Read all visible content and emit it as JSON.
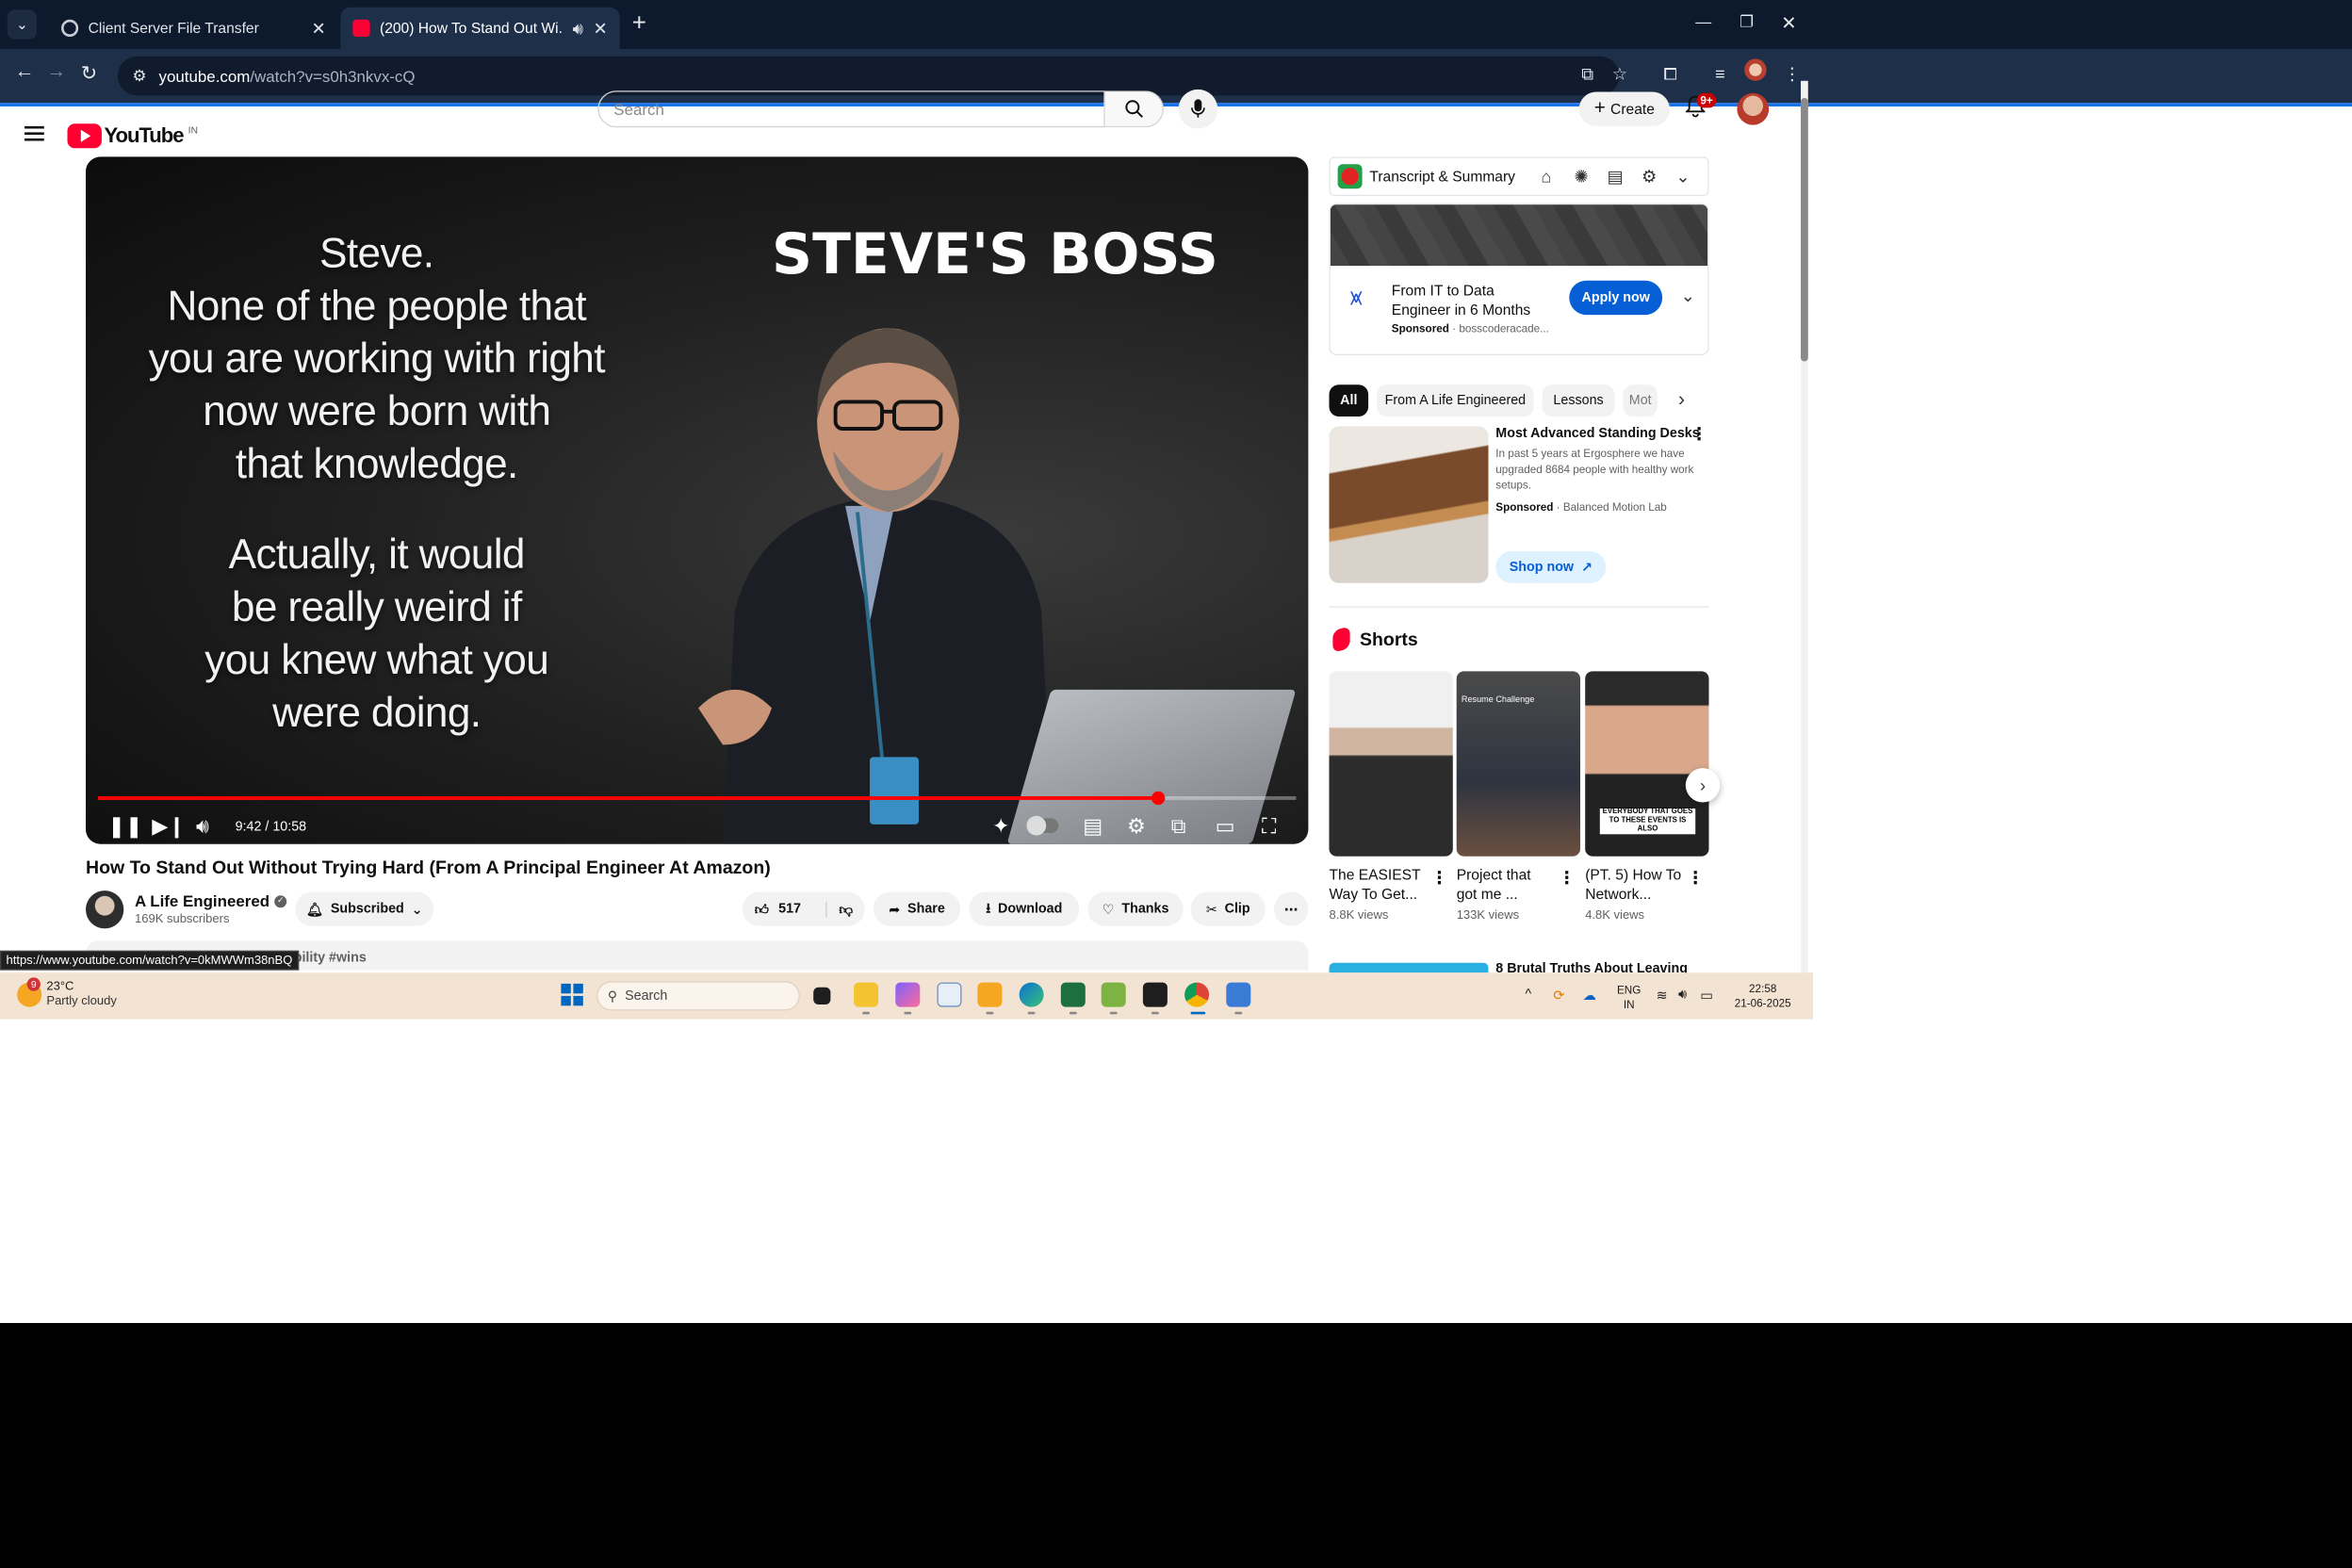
{
  "browser": {
    "tabs": [
      {
        "title": "Client Server File Transfer"
      },
      {
        "title": "(200) How To Stand Out Wi..."
      }
    ],
    "url_host": "youtube.com",
    "url_path": "/watch?v=s0h3nkvx-cQ"
  },
  "youtube": {
    "logo_text": "YouTube",
    "country_code": "IN",
    "search_placeholder": "Search",
    "create_label": "Create",
    "notif_count": "9+"
  },
  "video": {
    "overlay_left": "Steve.\nNone of the people that\nyou are working with right\nnow were born with\nthat knowledge.",
    "overlay_left_2": "Actually, it would\nbe really weird if\nyou knew what you\nwere doing.",
    "overlay_right": "STEVE'S BOSS",
    "time": "9:42 / 10:58",
    "progress": 0.884,
    "title": "How To Stand Out Without Trying Hard (From A Principal Engineer At Amazon)"
  },
  "channel": {
    "name": "A Life Engineered",
    "subscribers": "169K subscribers",
    "subscribed_label": "Subscribed"
  },
  "actions": {
    "likes": "517",
    "share": "Share",
    "download": "Download",
    "thanks": "Thanks",
    "clip": "Clip"
  },
  "description_peek": "tability #wins",
  "status_url": "https://www.youtube.com/watch?v=0kMWWm38nBQ",
  "sidebar": {
    "extension_title": "Transcript & Summary",
    "ad": {
      "title": "From IT to Data Engineer in 6 Months",
      "sponsored": "Sponsored",
      "advertiser": "bosscoderacade...",
      "cta": "Apply now"
    },
    "chips": [
      "All",
      "From A Life Engineered",
      "Lessons",
      "Mot"
    ],
    "promo": {
      "title": "Most Advanced Standing Desks",
      "description": "In past 5 years at Ergosphere we have upgraded 8684 people with healthy work setups.",
      "sponsored": "Sponsored",
      "advertiser": "Balanced Motion Lab",
      "cta": "Shop now"
    },
    "shorts_heading": "Shorts",
    "shorts": [
      {
        "title": "The EASIEST Way To Get...",
        "views": "8.8K views"
      },
      {
        "title": "Project that got me ...",
        "views": "133K views"
      },
      {
        "title": "(PT. 5) How To Network...",
        "views": "4.8K views"
      }
    ],
    "short2_overlay": "Resume Challenge",
    "short3_overlay": "EVERYBODY THAT GOES TO THESE EVENTS IS ALSO",
    "next_title": "8 Brutal Truths About Leaving"
  },
  "taskbar": {
    "temp": "23°C",
    "condition": "Partly cloudy",
    "weather_badge": "9",
    "search_label": "Search",
    "lang": "ENG",
    "region": "IN",
    "time": "22:58",
    "date": "21-06-2025"
  }
}
